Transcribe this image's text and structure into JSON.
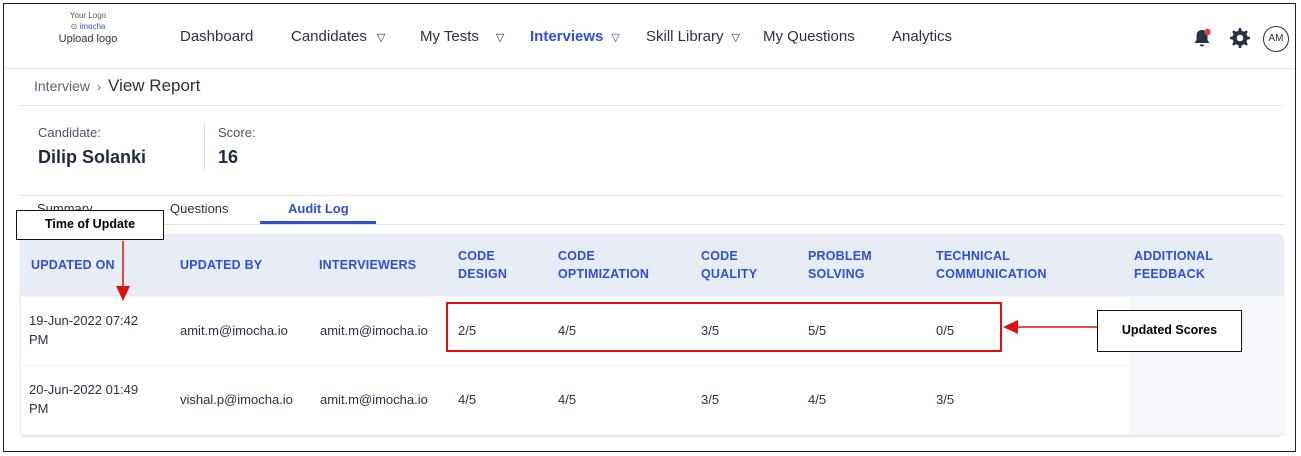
{
  "logo": {
    "line1": "Your Logo",
    "brand": "imocha",
    "upload": "Upload logo"
  },
  "nav": {
    "dashboard": "Dashboard",
    "candidates": "Candidates",
    "my_tests": "My Tests",
    "interviews": "Interviews",
    "skill_library": "Skill Library",
    "my_questions": "My Questions",
    "analytics": "Analytics",
    "caret": "▽"
  },
  "user": {
    "initials": "AM"
  },
  "breadcrumb": {
    "parent": "Interview",
    "separator": "›",
    "current": "View Report"
  },
  "candidate": {
    "label": "Candidate:",
    "name": "Dilip Solanki"
  },
  "score": {
    "label": "Score:",
    "value": "16"
  },
  "tabs": [
    {
      "label": "Summary"
    },
    {
      "label": "Questions"
    },
    {
      "label": "Audit Log"
    }
  ],
  "table": {
    "headers": {
      "updated_on": "UPDATED ON",
      "updated_by": "UPDATED BY",
      "interviewers": "INTERVIEWERS",
      "code_design_1": "CODE",
      "code_design_2": "DESIGN",
      "code_opt_1": "CODE",
      "code_opt_2": "OPTIMIZATION",
      "code_quality_1": "CODE",
      "code_quality_2": "QUALITY",
      "problem_1": "PROBLEM",
      "problem_2": "SOLVING",
      "tech_1": "TECHNICAL",
      "tech_2": "COMMUNICATION",
      "feedback_1": "ADDITIONAL",
      "feedback_2": "FEEDBACK"
    },
    "rows": [
      {
        "date": "19-Jun-2022 07:42",
        "time": "PM",
        "updated_by": "amit.m@imocha.io",
        "interviewers": "amit.m@imocha.io",
        "code_design": "2/5",
        "code_optimization": "4/5",
        "code_quality": "3/5",
        "problem_solving": "5/5",
        "technical_communication": "0/5"
      },
      {
        "date": "20-Jun-2022 01:49",
        "time": "PM",
        "updated_by": "vishal.p@imocha.io",
        "interviewers": "amit.m@imocha.io",
        "code_design": "4/5",
        "code_optimization": "4/5",
        "code_quality": "3/5",
        "problem_solving": "4/5",
        "technical_communication": "3/5"
      }
    ]
  },
  "annotations": {
    "time_of_update": "Time of Update",
    "updated_scores": "Updated Scores"
  },
  "colors": {
    "accent": "#2f4fd8",
    "annotation_red": "#e01010",
    "header_bg": "#e8edf5"
  }
}
